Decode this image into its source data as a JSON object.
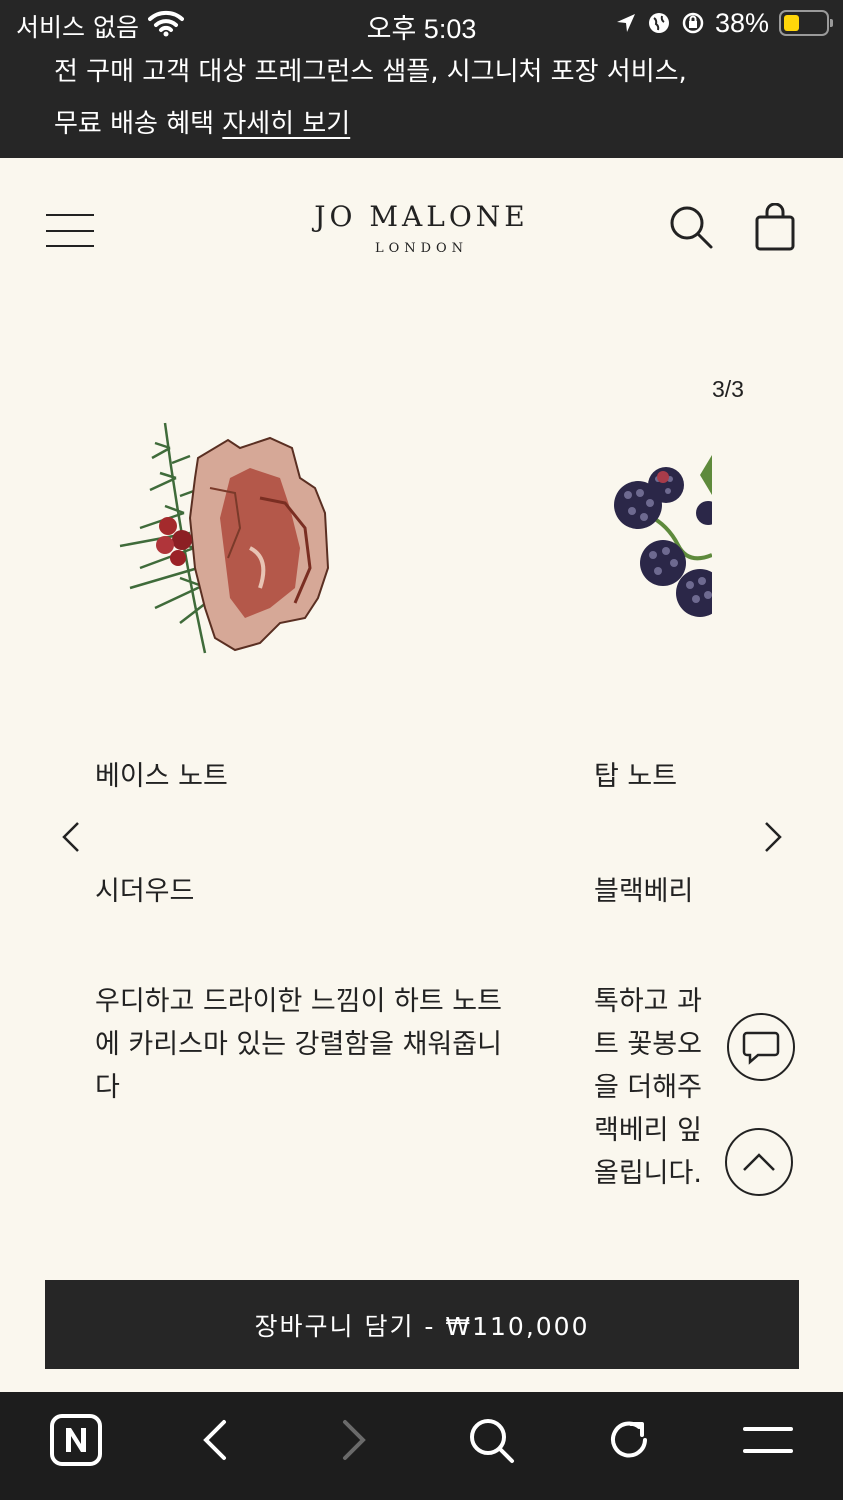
{
  "status_bar": {
    "carrier": "서비스 없음",
    "time": "오후 5:03",
    "battery_pct": "38%",
    "battery_level": 0.38,
    "battery_color": "#ffd60a"
  },
  "promo": {
    "line1": "전 구매 고객 대상 프레그런스 샘플, 시그니처 포장 서비스,",
    "line2": "무료 배송 혜택",
    "link": "자세히 보기"
  },
  "header": {
    "brand": "JO MALONE",
    "city": "LONDON",
    "icons": [
      "menu-icon",
      "search-icon",
      "shopping-bag-icon"
    ]
  },
  "carousel": {
    "counter": "3/3",
    "slides": [
      {
        "label": "베이스 노트",
        "name": "시더우드",
        "desc": [
          "우디하고 드라이한 느낌이 하트 노트",
          "에 카리스마 있는 강렬함을 채워줍니",
          "다"
        ],
        "image": "cedarwood-illustration"
      },
      {
        "label": "탑 노트",
        "name": "블랙베리",
        "desc": [
          "톡하고 과",
          "트 꽃봉오",
          "을 더해주",
          "랙베리 잎",
          "올립니다."
        ],
        "image": "blackberry-illustration"
      }
    ]
  },
  "cart": {
    "label": "장바구니 담기 - ₩110,000"
  },
  "colors": {
    "background": "#faf7ee",
    "dark": "#262626"
  }
}
